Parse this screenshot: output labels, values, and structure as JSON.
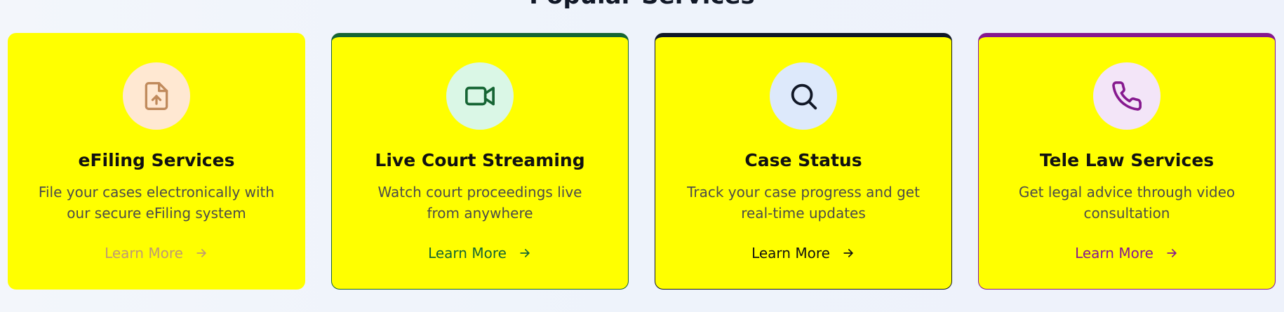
{
  "section": {
    "heading": "Popular Services"
  },
  "cards": [
    {
      "title": "eFiling Services",
      "description": "File your cases electronically with our secure eFiling system",
      "link_label": "Learn More",
      "icon": "file-upload-icon",
      "icon_bg": "#ffe8d2",
      "icon_color": "#c08a5c",
      "link_color": "#bf9a72"
    },
    {
      "title": "Live Court Streaming",
      "description": "Watch court proceedings live from anywhere",
      "link_label": "Learn More",
      "icon": "video-camera-icon",
      "icon_bg": "#daf7e6",
      "icon_color": "#166534",
      "link_color": "#166534",
      "accent": "#166534"
    },
    {
      "title": "Case Status",
      "description": "Track your case progress and get real-time updates",
      "link_label": "Learn More",
      "icon": "search-icon",
      "icon_bg": "#dde9fb",
      "icon_color": "#111827",
      "link_color": "#111111",
      "accent": "#111827"
    },
    {
      "title": "Tele Law Services",
      "description": "Get legal advice through video consultation",
      "link_label": "Learn More",
      "icon": "phone-icon",
      "icon_bg": "#f3e5f8",
      "icon_color": "#86198f",
      "link_color": "#86198f",
      "accent": "#86198f"
    }
  ]
}
